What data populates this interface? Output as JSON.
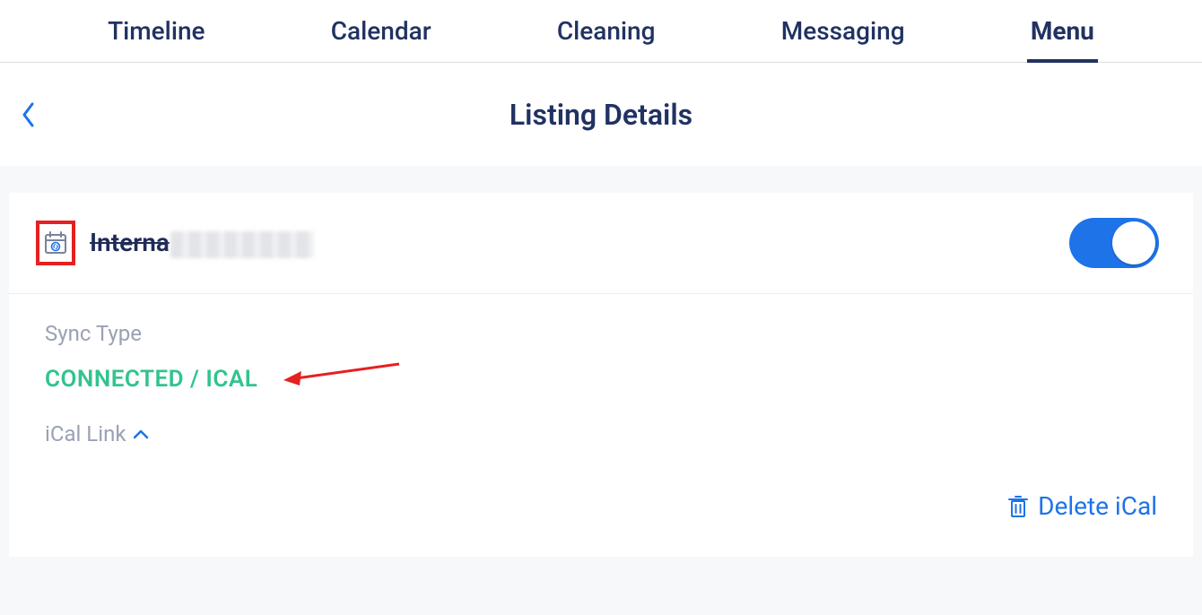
{
  "tabs": {
    "timeline": "Timeline",
    "calendar": "Calendar",
    "cleaning": "Cleaning",
    "messaging": "Messaging",
    "menu": "Menu"
  },
  "page_title": "Listing Details",
  "listing": {
    "name_visible_fragment": "Interna",
    "toggle_on": true
  },
  "sync": {
    "label": "Sync Type",
    "status": "CONNECTED / ICAL",
    "ical_link_label": "iCal Link"
  },
  "actions": {
    "delete_ical": "Delete iCal"
  },
  "icons": {
    "back": "chevron-left-icon",
    "calendar_link": "calendar-link-icon",
    "chevron_up": "chevron-up-icon",
    "trash": "trash-icon"
  }
}
